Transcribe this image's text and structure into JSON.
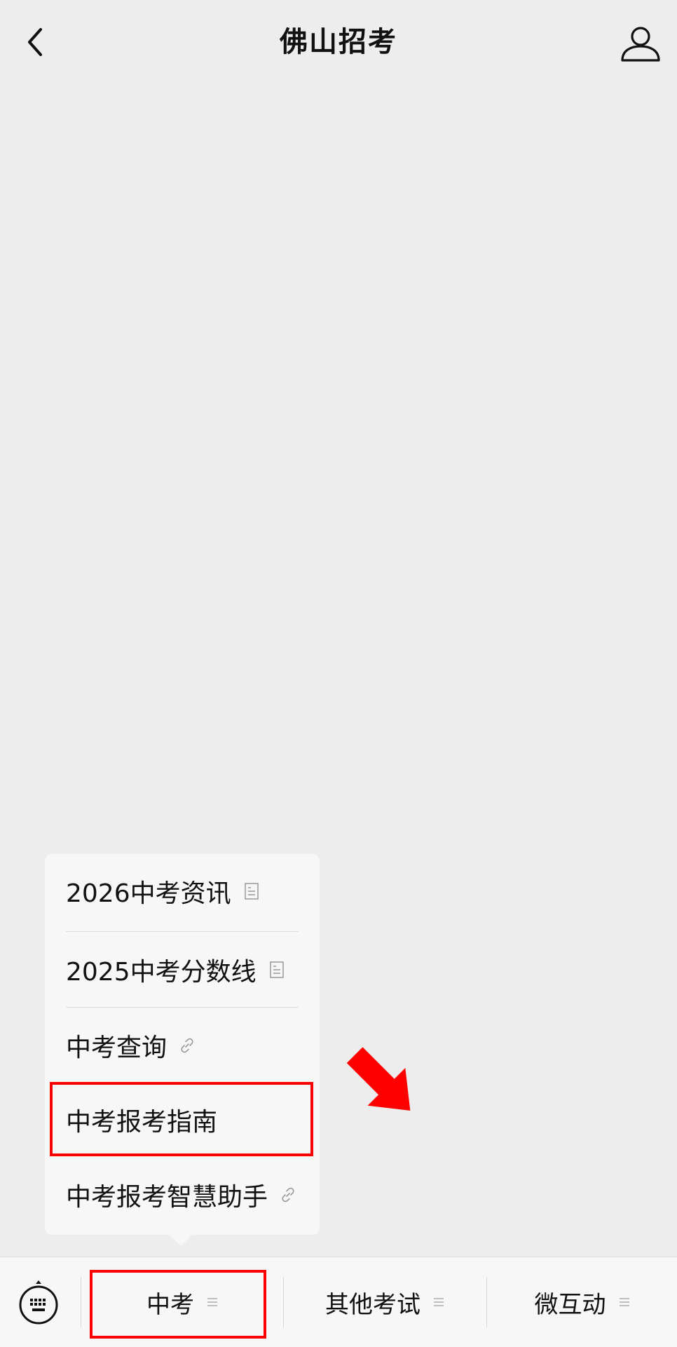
{
  "header": {
    "title": "佛山招考",
    "back_icon": "chevron-left-icon",
    "profile_icon": "user-icon"
  },
  "popup_menu": {
    "items": [
      {
        "label": "2026中考资讯",
        "icon": "document-icon"
      },
      {
        "label": "2025中考分数线",
        "icon": "document-icon"
      },
      {
        "label": "中考查询",
        "icon": "link-icon"
      },
      {
        "label": "中考报考指南",
        "icon": ""
      },
      {
        "label": "中考报考智慧助手",
        "icon": "link-icon"
      }
    ]
  },
  "tabbar": {
    "keyboard_icon": "keyboard-icon",
    "tabs": [
      {
        "label": "中考",
        "icon": "menu-lines-icon"
      },
      {
        "label": "其他考试",
        "icon": "menu-lines-icon"
      },
      {
        "label": "微互动",
        "icon": "menu-lines-icon"
      }
    ]
  },
  "annotations": {
    "color": "#ff0000",
    "highlighted_menu_item": "中考报考指南",
    "highlighted_tab": "中考",
    "arrow_icon": "red-arrow-icon"
  }
}
